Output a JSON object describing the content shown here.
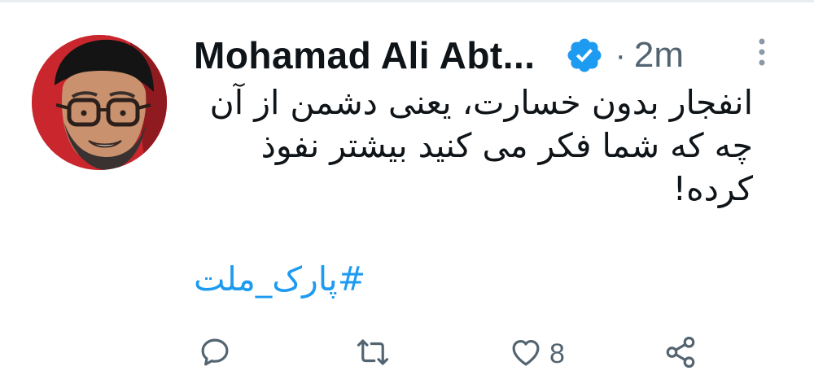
{
  "tweet": {
    "author_name": "Mohamad Ali Abt...",
    "separator": "·",
    "time": "2m",
    "text": "انفجار بدون خسارت، یعنی دشمن از آن چه که شما فکر می کنید بیشتر نفوذ کرده!",
    "hashtag": "#پارک_ملت",
    "like_count": "8"
  },
  "icons": {
    "verified": "verified-badge-icon",
    "more": "more-vertical-icon",
    "reply": "reply-icon",
    "retweet": "retweet-icon",
    "like": "heart-icon",
    "share": "share-icon"
  },
  "colors": {
    "accent": "#1d9bf0",
    "text": "#0f1419",
    "muted": "#536471",
    "avatar_background": "#c9272d"
  }
}
